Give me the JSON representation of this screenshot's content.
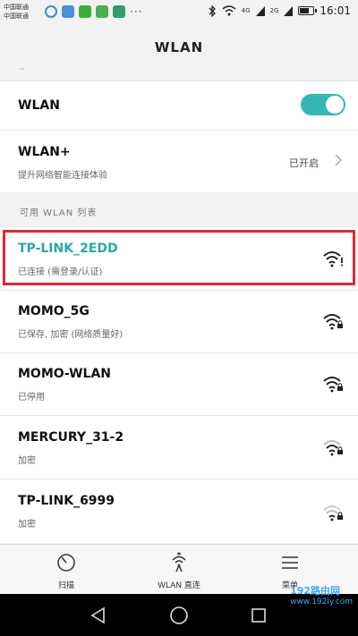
{
  "status_bar": {
    "carrier_1": "中国联通",
    "carrier_2": "中国联通",
    "net_1": "4G",
    "net_2": "2G",
    "time": "16:01",
    "more": "···",
    "battery_level": 0.7
  },
  "title": "WLAN",
  "truncated_header": "··",
  "wlan_row": {
    "label": "WLAN",
    "toggle_on": true
  },
  "wlanplus_row": {
    "label": "WLAN+",
    "sub": "提升网络智能连接体验",
    "state": "已开启"
  },
  "section_title": "可用 WLAN 列表",
  "networks": [
    {
      "name": "TP-LINK_2EDD",
      "status": "已连接 (需登录/认证)",
      "icon": "wifi-alert-icon",
      "highlighted": true
    },
    {
      "name": "MOMO_5G",
      "status": "已保存, 加密 (网络质量好)",
      "icon": "wifi-lock-icon"
    },
    {
      "name": "MOMO-WLAN",
      "status": "已停用",
      "icon": "wifi-lock-icon"
    },
    {
      "name": "MERCURY_31-2",
      "status": "加密",
      "icon": "wifi-lock-icon"
    },
    {
      "name": "TP-LINK_6999",
      "status": "加密",
      "icon": "wifi-lock-icon"
    }
  ],
  "tabs": [
    {
      "label": "扫描",
      "icon": "scan-icon"
    },
    {
      "label": "WLAN 直连",
      "icon": "wlan-direct-icon"
    },
    {
      "label": "菜单",
      "icon": "menu-icon"
    }
  ],
  "watermark": {
    "text": "192路由网",
    "sub": "www.192ly.com"
  },
  "colors": {
    "accent": "#36b6b6",
    "highlight": "#e3262e",
    "connected": "#2aa8a8"
  }
}
